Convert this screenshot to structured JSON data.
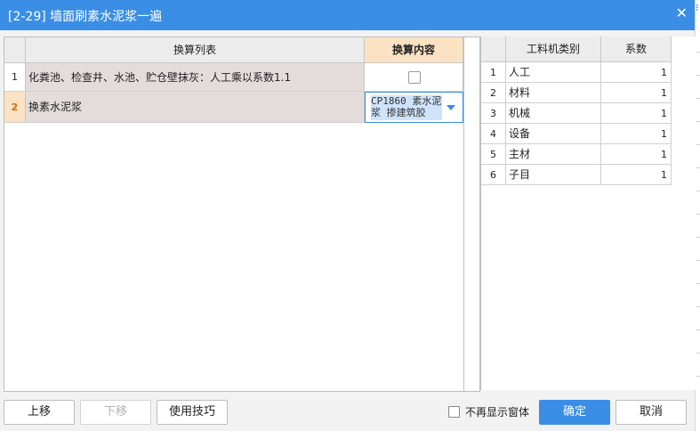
{
  "window": {
    "title": "[2-29] 墙面刷素水泥浆一遍"
  },
  "left_table": {
    "headers": [
      "换算列表",
      "换算内容"
    ],
    "rows": [
      {
        "num": "1",
        "text": "化粪池、检查井、水池、贮仓壁抹灰：人工乘以系数1.1",
        "content_type": "checkbox",
        "checked": false
      },
      {
        "num": "2",
        "text": "换素水泥浆",
        "content_type": "dropdown",
        "value": "CP1860 素水泥浆 掺建筑胶"
      }
    ]
  },
  "right_table": {
    "headers": [
      "工料机类别",
      "系数"
    ],
    "rows": [
      {
        "num": "1",
        "category": "人工",
        "coef": "1"
      },
      {
        "num": "2",
        "category": "材料",
        "coef": "1"
      },
      {
        "num": "3",
        "category": "机械",
        "coef": "1"
      },
      {
        "num": "4",
        "category": "设备",
        "coef": "1"
      },
      {
        "num": "5",
        "category": "主材",
        "coef": "1"
      },
      {
        "num": "6",
        "category": "子目",
        "coef": "1"
      }
    ]
  },
  "buttons": {
    "move_up": "上移",
    "move_down": "下移",
    "tips": "使用技巧",
    "ok": "确定",
    "cancel": "取消"
  },
  "no_show": {
    "label": "不再显示窗体",
    "checked": false
  },
  "icons": {
    "close": "close-icon",
    "dropdown": "chevron-down-icon"
  },
  "colors": {
    "title_bar": "#3a8ee6",
    "header_highlight": "#fbe2c2",
    "row_bg": "#e3dcda",
    "primary": "#3a8ee6"
  }
}
